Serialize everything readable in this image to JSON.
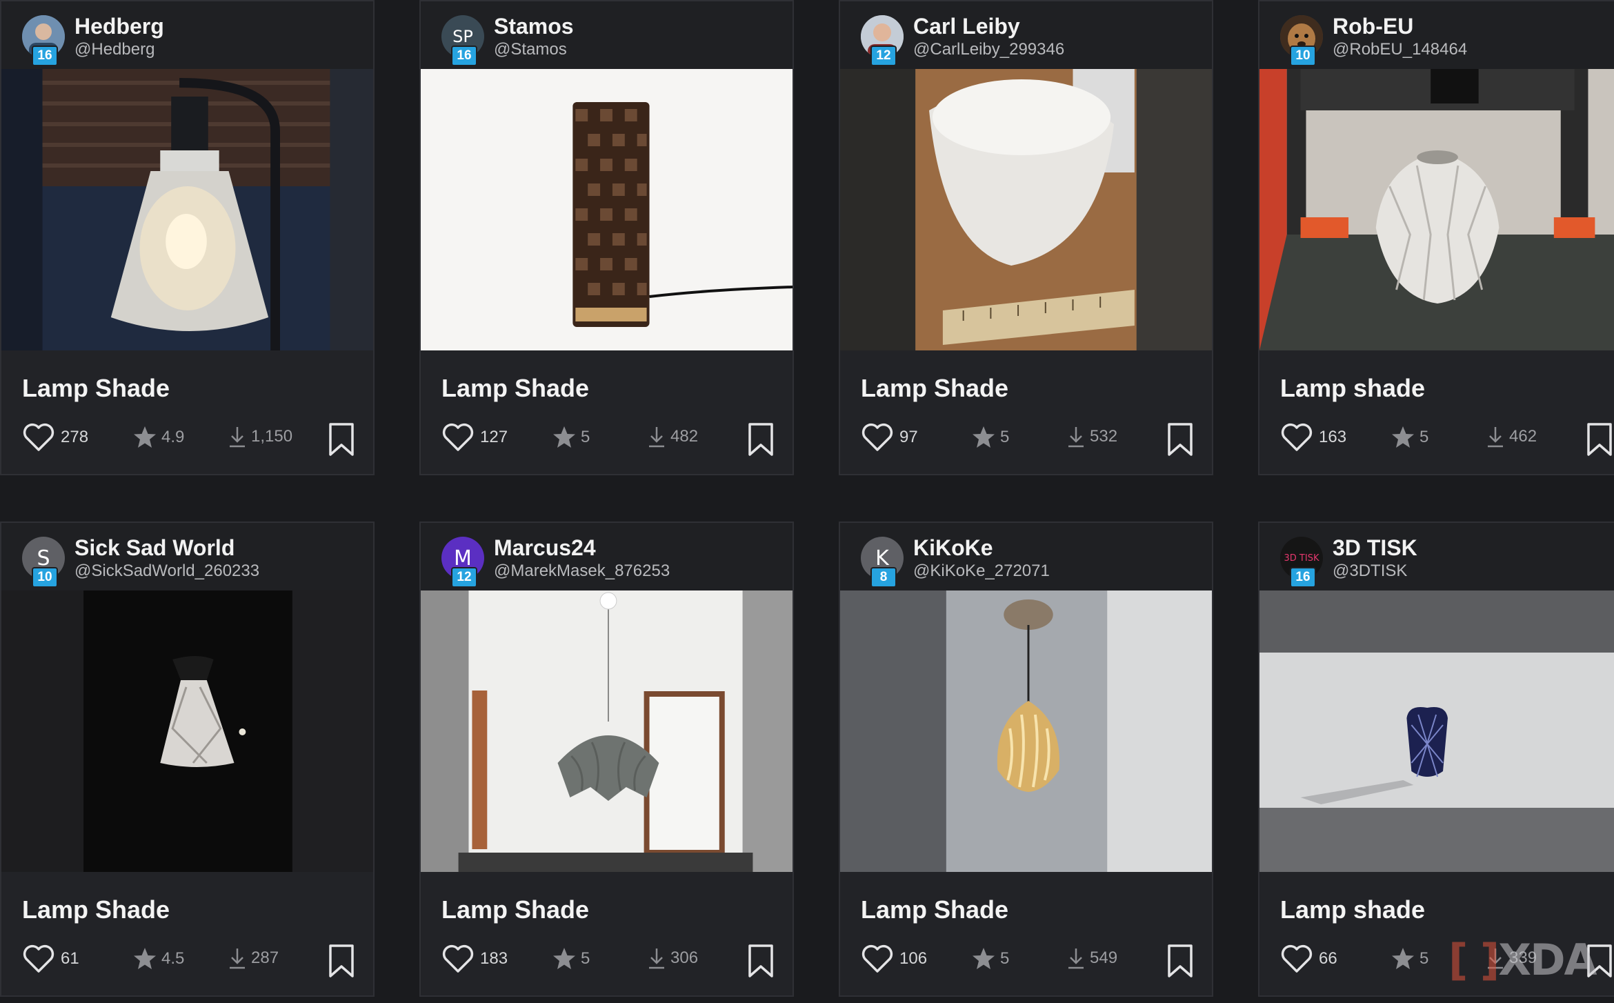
{
  "cards": [
    {
      "author_name": "Hedberg",
      "author_handle": "@Hedberg",
      "avatar_text": "",
      "level": "16",
      "title": "Lamp Shade",
      "likes": "278",
      "rating": "4.9",
      "downloads": "1,150"
    },
    {
      "author_name": "Stamos",
      "author_handle": "@Stamos",
      "avatar_text": "SP",
      "level": "16",
      "title": "Lamp Shade",
      "likes": "127",
      "rating": "5",
      "downloads": "482"
    },
    {
      "author_name": "Carl Leiby",
      "author_handle": "@CarlLeiby_299346",
      "avatar_text": "",
      "level": "12",
      "title": "Lamp Shade",
      "likes": "97",
      "rating": "5",
      "downloads": "532"
    },
    {
      "author_name": "Rob-EU",
      "author_handle": "@RobEU_148464",
      "avatar_text": "",
      "level": "10",
      "title": "Lamp shade",
      "likes": "163",
      "rating": "5",
      "downloads": "462"
    },
    {
      "author_name": "Sick Sad World",
      "author_handle": "@SickSadWorld_260233",
      "avatar_text": "S",
      "level": "10",
      "title": "Lamp Shade",
      "likes": "61",
      "rating": "4.5",
      "downloads": "287"
    },
    {
      "author_name": "Marcus24",
      "author_handle": "@MarekMasek_876253",
      "avatar_text": "M",
      "level": "12",
      "title": "Lamp Shade",
      "likes": "183",
      "rating": "5",
      "downloads": "306"
    },
    {
      "author_name": "KiKoKe",
      "author_handle": "@KiKoKe_272071",
      "avatar_text": "K",
      "level": "8",
      "title": "Lamp Shade",
      "likes": "106",
      "rating": "5",
      "downloads": "549"
    },
    {
      "author_name": "3D TISK",
      "author_handle": "@3DTISK",
      "avatar_text": "3D TISK",
      "level": "16",
      "title": "Lamp shade",
      "likes": "66",
      "rating": "5",
      "downloads": "339"
    }
  ],
  "watermark": "XDA",
  "colors": {
    "background": "#1a1b1e",
    "card": "#222327",
    "level_badge": "#26a3e0",
    "text": "#f4f4f4",
    "muted": "#9d9ea2"
  },
  "icons": {
    "like": "heart-icon",
    "rating": "star-icon",
    "downloads": "download-icon",
    "save": "bookmark-icon"
  }
}
